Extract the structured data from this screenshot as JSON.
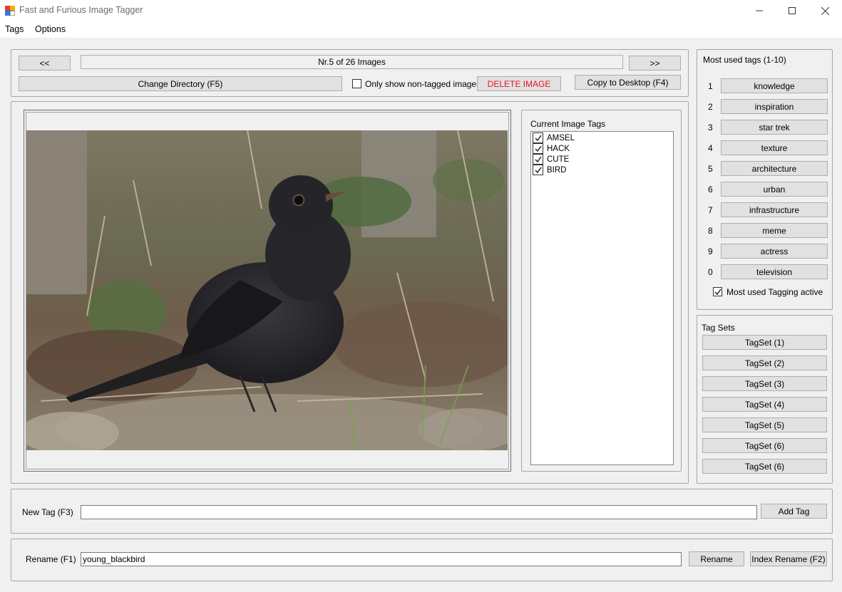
{
  "window": {
    "title": "Fast and Furious Image Tagger"
  },
  "menu": [
    "Tags",
    "Options"
  ],
  "nav": {
    "prev": "<<",
    "next": ">>",
    "counter": "Nr.5 of 26 Images",
    "change_dir": "Change Directory (F5)",
    "only_untagged": "Only show non-tagged images",
    "delete": "DELETE IMAGE",
    "copy_desktop": "Copy to Desktop (F4)"
  },
  "current_tags": {
    "title": "Current Image Tags",
    "items": [
      "AMSEL",
      "HACK",
      "CUTE",
      "BIRD"
    ]
  },
  "most_used": {
    "title": "Most used tags (1-10)",
    "items": [
      {
        "key": "1",
        "tag": "knowledge"
      },
      {
        "key": "2",
        "tag": "inspiration"
      },
      {
        "key": "3",
        "tag": "star trek"
      },
      {
        "key": "4",
        "tag": "texture"
      },
      {
        "key": "5",
        "tag": "architecture"
      },
      {
        "key": "6",
        "tag": "urban"
      },
      {
        "key": "7",
        "tag": "infrastructure"
      },
      {
        "key": "8",
        "tag": "meme"
      },
      {
        "key": "9",
        "tag": "actress"
      },
      {
        "key": "0",
        "tag": "television"
      }
    ],
    "active_label": "Most used Tagging active"
  },
  "tag_sets": {
    "title": "Tag Sets",
    "items": [
      "TagSet (1)",
      "TagSet (2)",
      "TagSet (3)",
      "TagSet (4)",
      "TagSet (5)",
      "TagSet (6)",
      "TagSet (6)"
    ]
  },
  "new_tag": {
    "label": "New Tag (F3)",
    "value": "",
    "button": "Add Tag"
  },
  "rename": {
    "label": "Rename (F1)",
    "value": "young_blackbird",
    "button": "Rename",
    "index_button": "Index Rename (F2)"
  },
  "colors": {
    "delete_text": "#e81123",
    "window_bg": "#f0f0f0",
    "button_bg": "#e1e1e1"
  }
}
